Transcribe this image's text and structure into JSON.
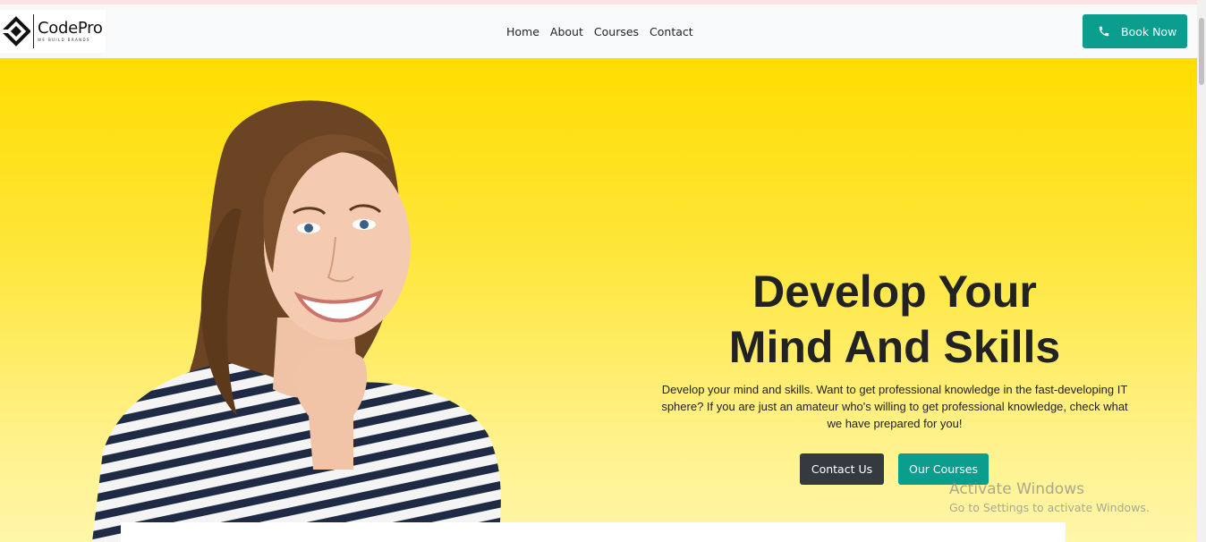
{
  "brand": {
    "name": "CodePro",
    "tagline": "WE BUILD BRANDS"
  },
  "nav": {
    "links": [
      "Home",
      "About",
      "Courses",
      "Contact"
    ],
    "cta_label": "Book Now",
    "cta_icon": "phone-icon"
  },
  "hero": {
    "title_line1": "Develop Your",
    "title_line2": "Mind And Skills",
    "description": "Develop your mind and skills. Want to get professional knowledge in the fast-developing IT sphere? If you are just an amateur who's willing to get professional knowledge, check what we have prepared for you!",
    "primary_button": "Contact Us",
    "secondary_button": "Our Courses"
  },
  "watermark": {
    "title": "Activate Windows",
    "subtitle": "Go to Settings to activate Windows."
  },
  "colors": {
    "accent": "#0b9e8f",
    "dark_button": "#343a40",
    "hero_top": "#ffdd00",
    "hero_bottom": "#fff6a8"
  }
}
